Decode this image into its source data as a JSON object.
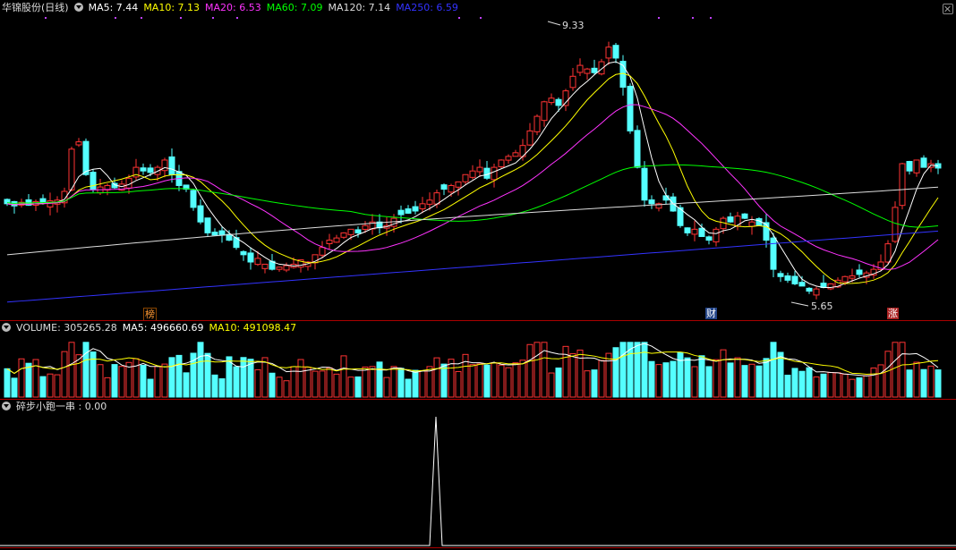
{
  "main": {
    "title": "华锦股份(日线)",
    "ma_legend": [
      {
        "label": "MA5: 7.44",
        "color": "#ffffff"
      },
      {
        "label": "MA10: 7.13",
        "color": "#ffff00"
      },
      {
        "label": "MA20: 6.53",
        "color": "#ff33ff"
      },
      {
        "label": "MA60: 7.09",
        "color": "#00ff00"
      },
      {
        "label": "MA120: 7.14",
        "color": "#dddddd"
      },
      {
        "label": "MA250: 6.59",
        "color": "#3333ff"
      }
    ],
    "high_label": "9.33",
    "low_label": "5.65",
    "markers": [
      "榜",
      "财",
      "涨"
    ]
  },
  "volume": {
    "title": "VOLUME: 305265.28",
    "ma5_label": "MA5: 496660.69",
    "ma10_label": "MA10: 491098.47"
  },
  "indicator": {
    "title": "碎步小跑一串 : 0.00"
  },
  "colors": {
    "up": "#ff3333",
    "down": "#54ffff",
    "ma5": "#ffffff",
    "ma10": "#ffff00",
    "ma20": "#ff33ff",
    "ma60": "#00ff00",
    "ma120": "#dddddd",
    "ma250": "#3333ff",
    "separator": "#aa0000"
  },
  "icons": [
    "collapse-toggle-icon",
    "close-icon"
  ],
  "chart_data": {
    "type": "candlestick",
    "high": 9.33,
    "low": 5.65,
    "close_series": [
      6.95,
      6.92,
      6.97,
      6.93,
      6.98,
      6.96,
      6.99,
      7.0,
      7.12,
      7.7,
      7.8,
      7.35,
      7.15,
      7.18,
      7.2,
      7.17,
      7.22,
      7.3,
      7.45,
      7.4,
      7.38,
      7.45,
      7.55,
      7.35,
      7.2,
      7.15,
      6.9,
      6.7,
      6.55,
      6.52,
      6.52,
      6.45,
      6.35,
      6.25,
      6.15,
      6.2,
      6.12,
      6.05,
      6.08,
      6.1,
      6.12,
      6.18,
      6.15,
      6.25,
      6.35,
      6.45,
      6.48,
      6.55,
      6.6,
      6.55,
      6.65,
      6.7,
      6.62,
      6.65,
      6.75,
      6.8,
      6.82,
      6.85,
      6.95,
      7.0,
      7.1,
      7.15,
      7.2,
      7.25,
      7.35,
      7.4,
      7.45,
      7.3,
      7.45,
      7.55,
      7.6,
      7.65,
      7.75,
      7.95,
      8.15,
      8.35,
      8.4,
      8.3,
      8.5,
      8.7,
      8.85,
      8.8,
      8.75,
      8.9,
      9.1,
      8.95,
      8.55,
      7.95,
      7.45,
      7.0,
      6.95,
      6.95,
      7.0,
      6.85,
      6.65,
      6.55,
      6.6,
      6.5,
      6.45,
      6.6,
      6.75,
      6.7,
      6.78,
      6.75,
      6.7,
      6.65,
      6.45,
      6.05,
      5.95,
      5.9,
      5.85,
      5.82,
      5.75,
      5.78,
      5.8,
      5.85,
      5.9,
      5.95,
      5.96,
      5.98,
      6.0,
      6.05,
      6.15,
      6.4,
      6.9,
      7.5,
      7.4,
      7.55,
      7.45,
      7.5,
      7.44
    ],
    "volume_ma5": 496660.69,
    "volume_ma10": 491098.47,
    "indicator_value": 0.0
  }
}
